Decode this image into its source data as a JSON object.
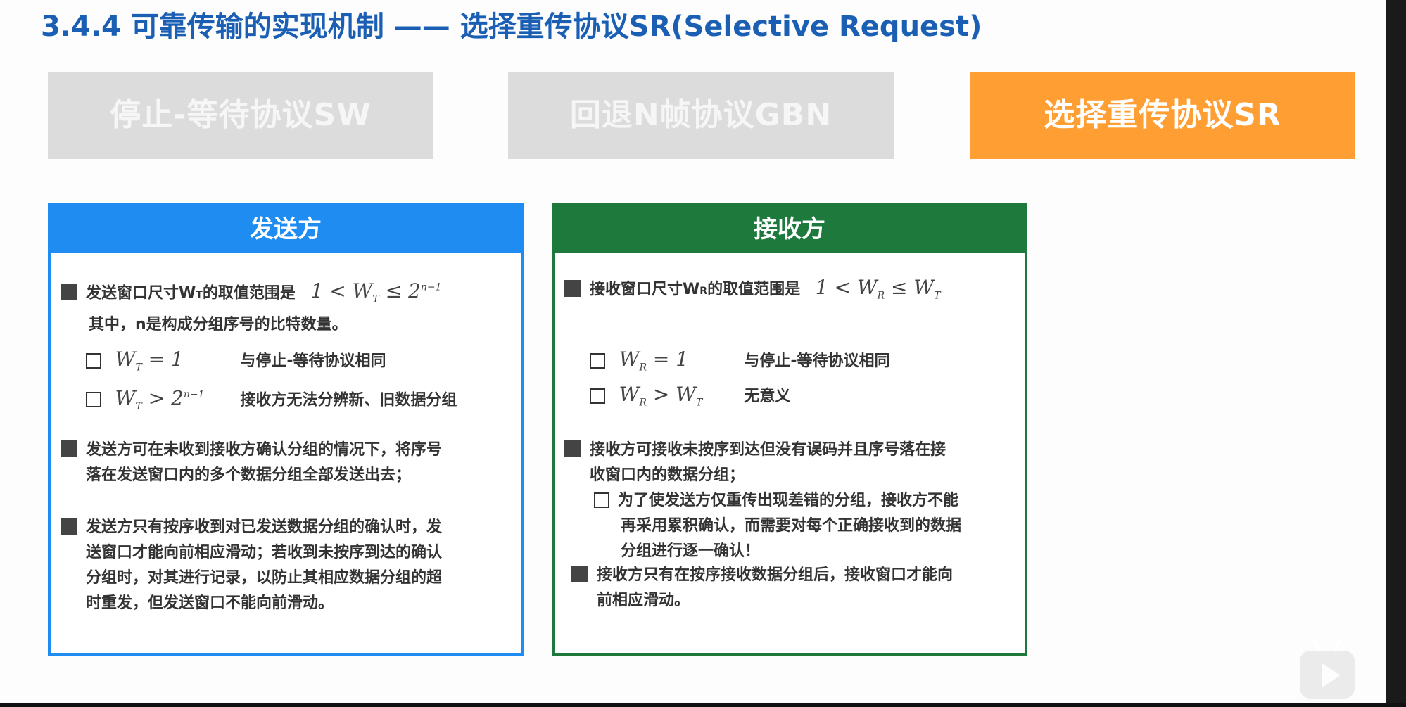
{
  "title": {
    "main": "3.4.4 可靠传输的实现机制 —— 选择重传协议SR(Selective Request)"
  },
  "tabs": [
    {
      "label": "停止-等待协议SW",
      "active": false
    },
    {
      "label": "回退N帧协议GBN",
      "active": false
    },
    {
      "label": "选择重传协议SR",
      "active": true
    }
  ],
  "colors": {
    "title": "#1a5fb4",
    "tab_inactive": "#dcdcdc",
    "tab_active": "#ff9f33",
    "sender": "#1e8cf0",
    "receiver": "#1e7a3c"
  },
  "sender": {
    "header": "发送方",
    "range_label": "发送窗口尺寸W",
    "range_sub": "T",
    "range_label_tail": "的取值范围是",
    "range_formula": "1 < W_T ≤ 2^(n-1)",
    "note": "其中，n是构成分组序号的比特数量。",
    "cases": [
      {
        "formula": "W_T = 1",
        "desc": "与停止-等待协议相同"
      },
      {
        "formula": "W_T > 2^(n-1)",
        "desc": "接收方无法分辨新、旧数据分组"
      }
    ],
    "point2_line1": "发送方可在未收到接收方确认分组的情况下，将序号",
    "point2_line2": "落在发送窗口内的多个数据分组全部发送出去；",
    "point3_line1": "发送方只有按序收到对已发送数据分组的确认时，发",
    "point3_line2": "送窗口才能向前相应滑动；若收到未按序到达的确认",
    "point3_line3": "分组时，对其进行记录，以防止其相应数据分组的超",
    "point3_line4": "时重发，但发送窗口不能向前滑动。"
  },
  "receiver": {
    "header": "接收方",
    "range_label": "接收窗口尺寸W",
    "range_sub": "R",
    "range_label_tail": "的取值范围是",
    "range_formula": "1 < W_R ≤ W_T",
    "cases": [
      {
        "formula": "W_R = 1",
        "desc": "与停止-等待协议相同"
      },
      {
        "formula": "W_R > W_T",
        "desc": "无意义"
      }
    ],
    "point2_line1": "接收方可接收未按序到达但没有误码并且序号落在接",
    "point2_line2": "收窗口内的数据分组；",
    "sub_line1": "为了使发送方仅重传出现差错的分组，接收方不能",
    "sub_line2": "再采用累积确认，而需要对每个正确接收到的数据",
    "sub_line3": "分组进行逐一确认！",
    "point3_line1": "接收方只有在按序接收数据分组后，接收窗口才能向",
    "point3_line2": "前相应滑动。"
  }
}
